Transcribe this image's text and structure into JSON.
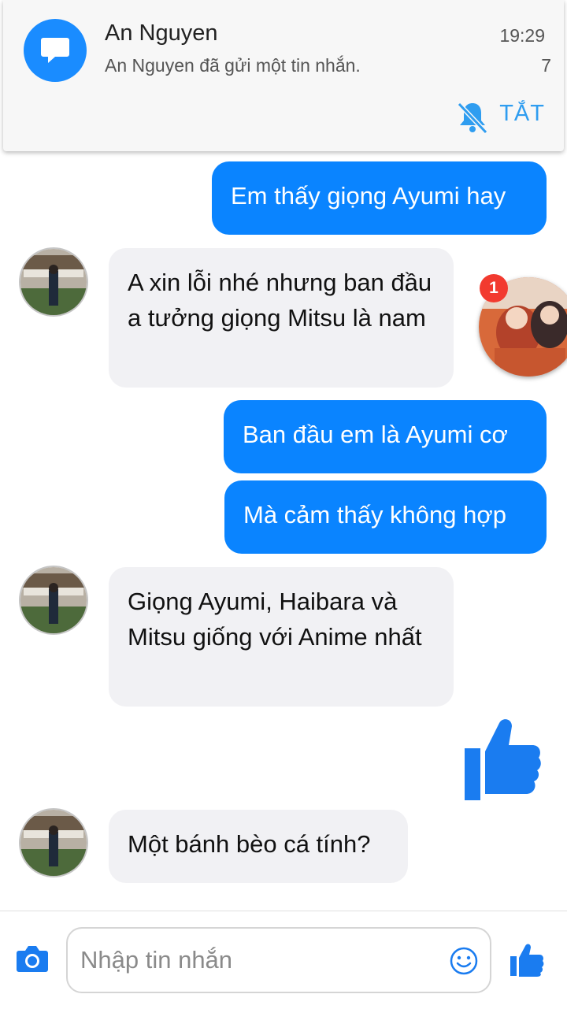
{
  "notification": {
    "sender": "An Nguyen",
    "message": "An Nguyen đã gửi một tin nhắn.",
    "time": "19:29",
    "count": "7",
    "action_off": "TẮT",
    "icons": [
      "chat-bubble-icon",
      "bell-muted-icon"
    ]
  },
  "messages": [
    {
      "direction": "outgoing",
      "text": "Em thấy giọng Ayumi hay"
    },
    {
      "direction": "incoming",
      "text": "A xin lỗi nhé nhưng ban đầu a tưởng giọng Mitsu là nam"
    },
    {
      "direction": "outgoing",
      "text": "Ban đầu em là Ayumi cơ"
    },
    {
      "direction": "outgoing",
      "text": "Mà cảm thấy không hợp"
    },
    {
      "direction": "incoming",
      "text": "Giọng Ayumi, Haibara và Mitsu giống với Anime nhất"
    },
    {
      "direction": "outgoing",
      "type": "like-sticker"
    },
    {
      "direction": "incoming",
      "text": "Một bánh bèo cá tính?"
    }
  ],
  "chathead": {
    "badge": "1"
  },
  "composer": {
    "placeholder": "Nhập tin nhắn",
    "icons": [
      "camera-icon",
      "emoji-icon",
      "thumbs-up-icon"
    ]
  },
  "colors": {
    "accent": "#0a84ff",
    "incoming_bubble": "#f1f1f4",
    "notification_icon": "#1a8cff",
    "badge": "#f23a2f",
    "action_text": "#2f9df0"
  }
}
